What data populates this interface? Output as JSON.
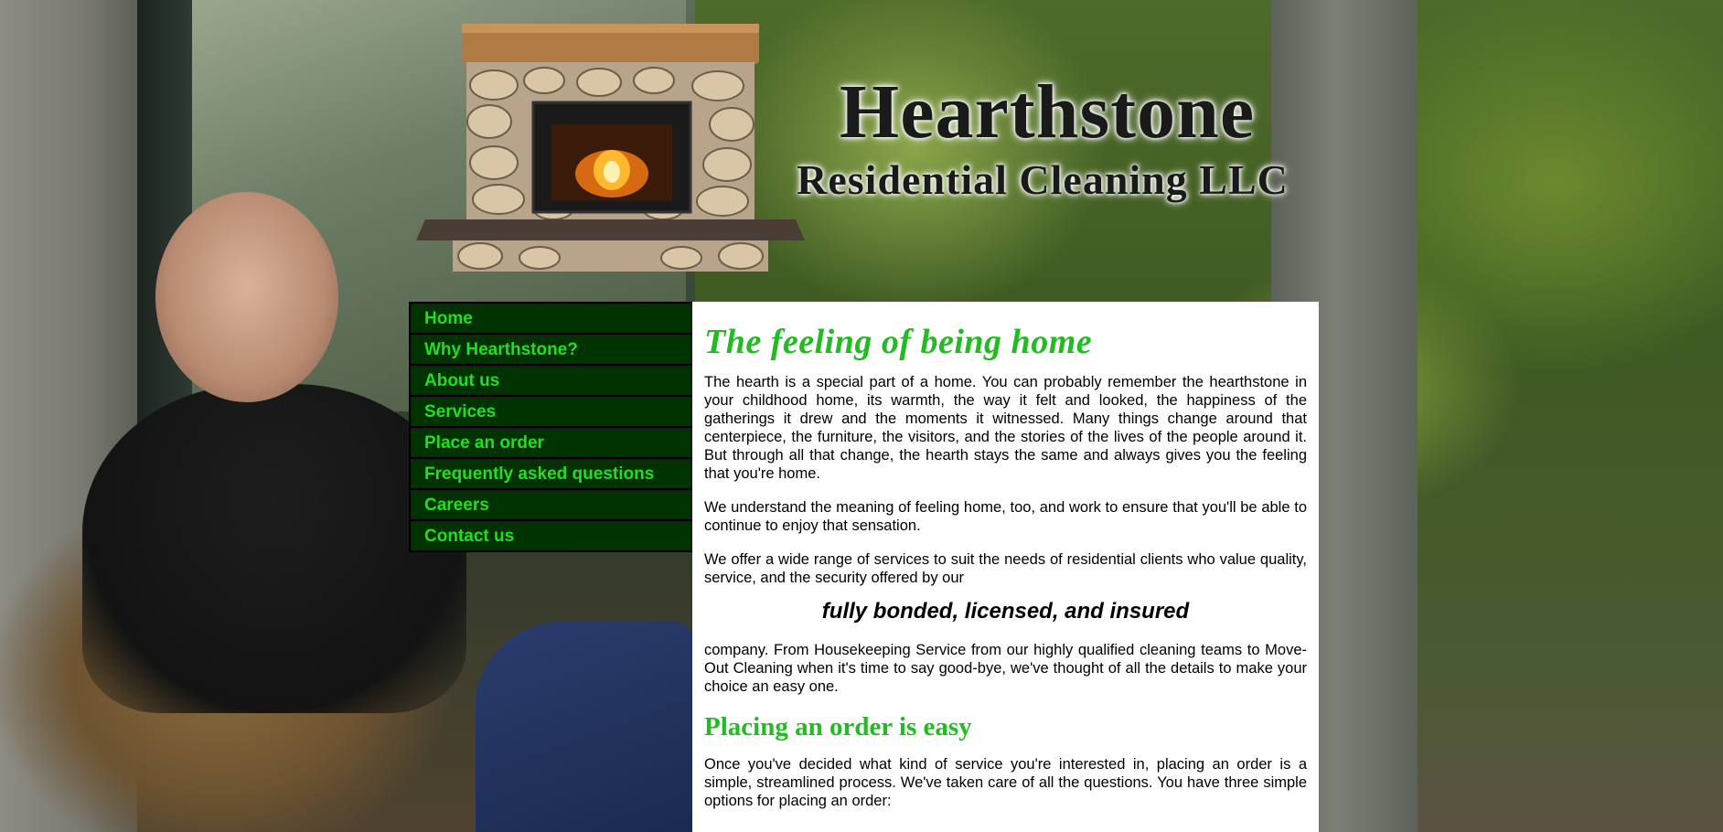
{
  "brand": {
    "title": "Hearthstone",
    "subtitle": "Residential Cleaning LLC"
  },
  "nav": {
    "items": [
      {
        "label": "Home"
      },
      {
        "label": "Why Hearthstone?"
      },
      {
        "label": "About us"
      },
      {
        "label": "Services"
      },
      {
        "label": "Place an order"
      },
      {
        "label": "Frequently asked questions"
      },
      {
        "label": "Careers"
      },
      {
        "label": "Contact us"
      }
    ]
  },
  "content": {
    "heading": "The feeling of being home",
    "p1": "The hearth is a special part of a home. You can probably remember the hearthstone in your childhood home, its warmth, the way it felt and looked, the happiness of the gatherings it drew and the moments it witnessed. Many things change around that centerpiece, the furniture, the visitors, and the stories of the lives of the people around it. But through all that change, the hearth stays the same and always gives you the feeling that you're home.",
    "p2": "We understand the meaning of feeling home, too, and work to ensure that you'll be able to continue to enjoy that sensation.",
    "p3": "We offer a wide range of services to suit the needs of residential clients who value quality, service, and the security offered by our",
    "emphasis": "fully bonded, licensed, and insured",
    "p4": "company. From Housekeeping Service from our highly qualified cleaning teams to Move-Out Cleaning when it's time to say good-bye, we've thought of all the details to make your choice an easy one.",
    "heading2": "Placing an order is easy",
    "p5": "Once you've decided what kind of service you're interested in, placing an order is a simple, streamlined process. We've taken care of all the questions. You have three simple options for placing an order:"
  },
  "colors": {
    "accent_green": "#22bb22",
    "nav_bg": "#003300",
    "nav_text": "#22dd22"
  },
  "icons": {
    "logo": "fireplace-icon"
  }
}
